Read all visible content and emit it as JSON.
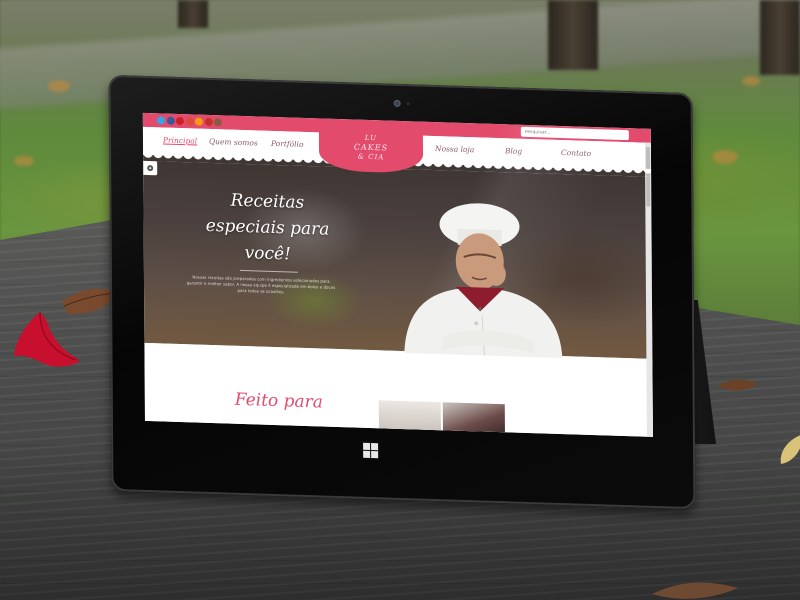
{
  "site": {
    "logo_lines": [
      "LU",
      "CAKES",
      "& CIA"
    ],
    "nav_items": [
      "Principal",
      "Quem somos",
      "Portfólio",
      "Nossa loja",
      "Blog",
      "Contato"
    ],
    "active_nav": "Principal",
    "search_placeholder": "Pesquisar...",
    "social_icons": [
      "twitter-icon",
      "facebook-icon",
      "pinterest-icon",
      "google-plus-icon",
      "rss-icon",
      "youtube-icon",
      "instagram-icon"
    ],
    "hero": {
      "title": "Receitas especiais para você!",
      "text": "Nossas receitas são preparadas com ingredientes selecionados para garantir o melhor sabor. A nossa equipe é especializada em bolos e doces para todas as ocasiões."
    },
    "section_title": "Feito para"
  },
  "colors": {
    "accent": "#e34b6d",
    "device_bezel": "#0a0a0a"
  }
}
